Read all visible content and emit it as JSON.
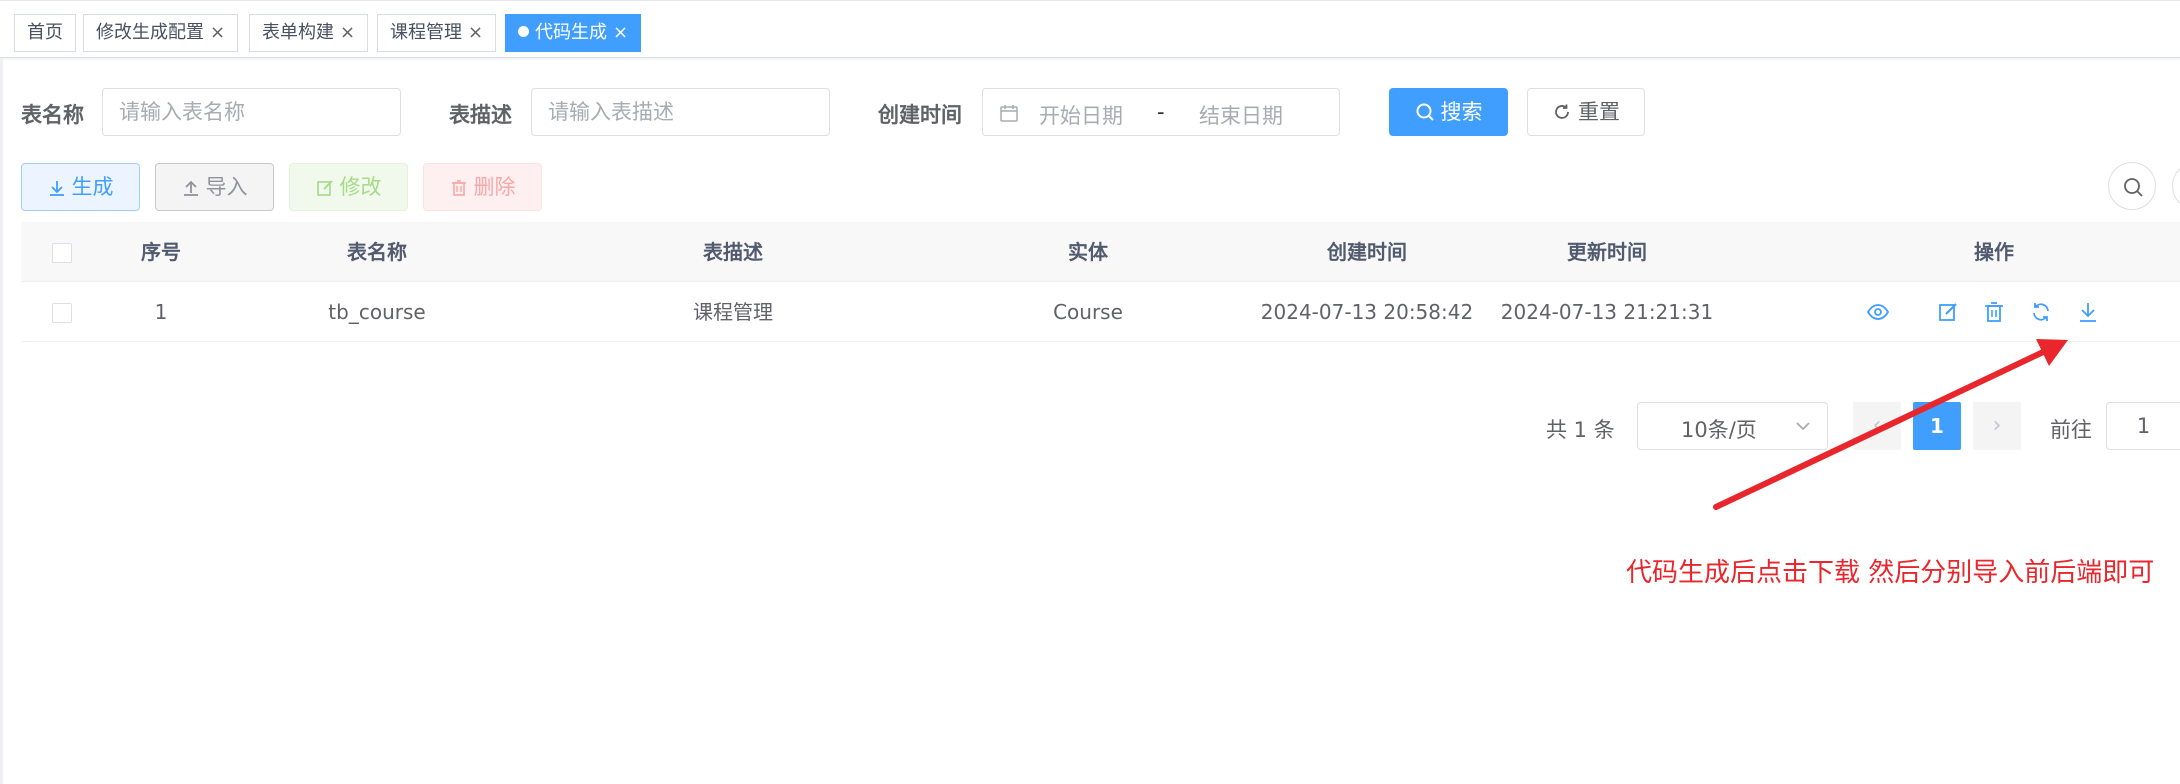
{
  "tags": [
    {
      "label": "首页",
      "closable": false,
      "active": false
    },
    {
      "label": "修改生成配置",
      "closable": true,
      "active": false
    },
    {
      "label": "表单构建",
      "closable": true,
      "active": false
    },
    {
      "label": "课程管理",
      "closable": true,
      "active": false
    },
    {
      "label": "代码生成",
      "closable": true,
      "active": true
    }
  ],
  "search": {
    "table_name_label": "表名称",
    "table_name_placeholder": "请输入表名称",
    "table_desc_label": "表描述",
    "table_desc_placeholder": "请输入表描述",
    "create_time_label": "创建时间",
    "start_date_placeholder": "开始日期",
    "range_separator": "-",
    "end_date_placeholder": "结束日期",
    "search_button": "搜索",
    "reset_button": "重置"
  },
  "toolbar": {
    "generate": "生成",
    "import": "导入",
    "edit": "修改",
    "delete": "删除"
  },
  "table": {
    "columns": [
      "序号",
      "表名称",
      "表描述",
      "实体",
      "创建时间",
      "更新时间",
      "操作"
    ],
    "rows": [
      {
        "index": "1",
        "table_name": "tb_course",
        "table_desc": "课程管理",
        "entity": "Course",
        "create_time": "2024-07-13 20:58:42",
        "update_time": "2024-07-13 21:21:31",
        "actions": [
          "preview-icon",
          "edit-icon",
          "delete-icon",
          "sync-icon",
          "download-icon"
        ]
      }
    ]
  },
  "pagination": {
    "total_text": "共 1 条",
    "page_size": "10条/页",
    "current_page": "1",
    "goto_label": "前往",
    "goto_value": "1"
  },
  "annotation": {
    "text": "代码生成后点击下载 然后分别导入前后端即可",
    "color": "#e8262b"
  },
  "colors": {
    "primary": "#409eff",
    "annotation_red": "#e8262b"
  }
}
